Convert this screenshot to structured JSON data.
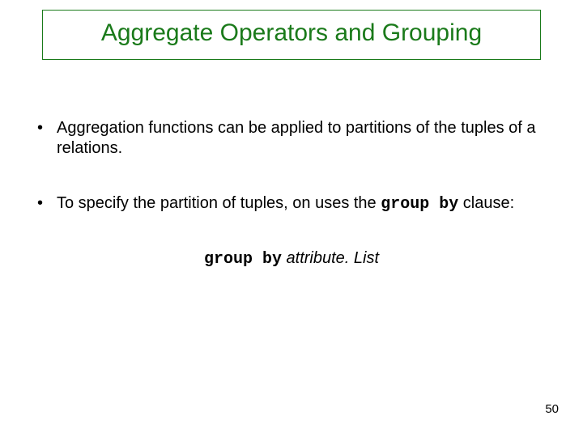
{
  "title": "Aggregate Operators and Grouping",
  "bullets": [
    {
      "text_before": "Aggregation functions can be applied to partitions of the tuples of a relations.",
      "mono": "",
      "text_after": ""
    },
    {
      "text_before": "To specify the partition of tuples, on uses the ",
      "mono": "group by",
      "text_after": " clause:"
    }
  ],
  "syntax": {
    "keyword": "group by",
    "attr": " attribute. List"
  },
  "page_number": "50"
}
